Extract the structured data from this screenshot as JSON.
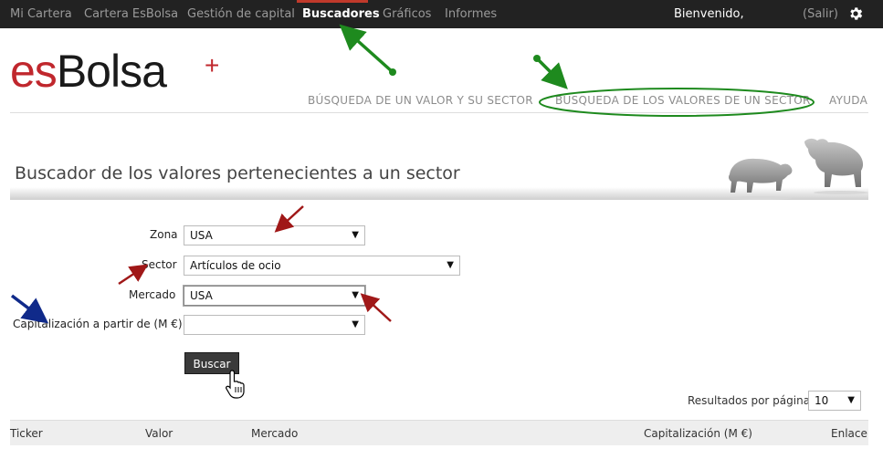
{
  "topnav": {
    "items": [
      {
        "label": "Mi Cartera",
        "active": false
      },
      {
        "label": "Cartera EsBolsa",
        "active": false
      },
      {
        "label": "Gestión de capital",
        "active": false
      },
      {
        "label": "Buscadores",
        "active": true
      },
      {
        "label": "Gráficos",
        "active": false
      },
      {
        "label": "Informes",
        "active": false
      }
    ],
    "welcome": "Bienvenido,",
    "logout": "(Salir)",
    "settings_icon": "gear-icon"
  },
  "logo": {
    "part1": "es",
    "part2": "Bolsa",
    "suffix": "+"
  },
  "subnav": {
    "items": [
      {
        "label": "BÚSQUEDA DE UN VALOR Y SU SECTOR"
      },
      {
        "label": "BÚSQUEDA DE LOS VALORES DE UN SECTOR",
        "highlighted": true
      },
      {
        "label": "AYUDA"
      }
    ]
  },
  "page": {
    "title": "Buscador de los valores pertenecientes a un sector"
  },
  "form": {
    "zona": {
      "label": "Zona",
      "value": "USA"
    },
    "sector": {
      "label": "Sector",
      "value": "Artículos de ocio"
    },
    "mercado": {
      "label": "Mercado",
      "value": "USA"
    },
    "capitalizacion": {
      "label": "Capitalización a partir de (M €)",
      "value": ""
    },
    "submit_label": "Buscar"
  },
  "results": {
    "per_page_label": "Resultados por página",
    "per_page_value": "10"
  },
  "table": {
    "columns": [
      "Ticker",
      "Valor",
      "Mercado",
      "Capitalización (M €)",
      "Enlace"
    ]
  },
  "colors": {
    "brand_red": "#c0272d",
    "nav_bg": "#222222",
    "annotation_green": "#1e8a1e",
    "annotation_red": "#a01818",
    "annotation_blue": "#102a8a"
  }
}
